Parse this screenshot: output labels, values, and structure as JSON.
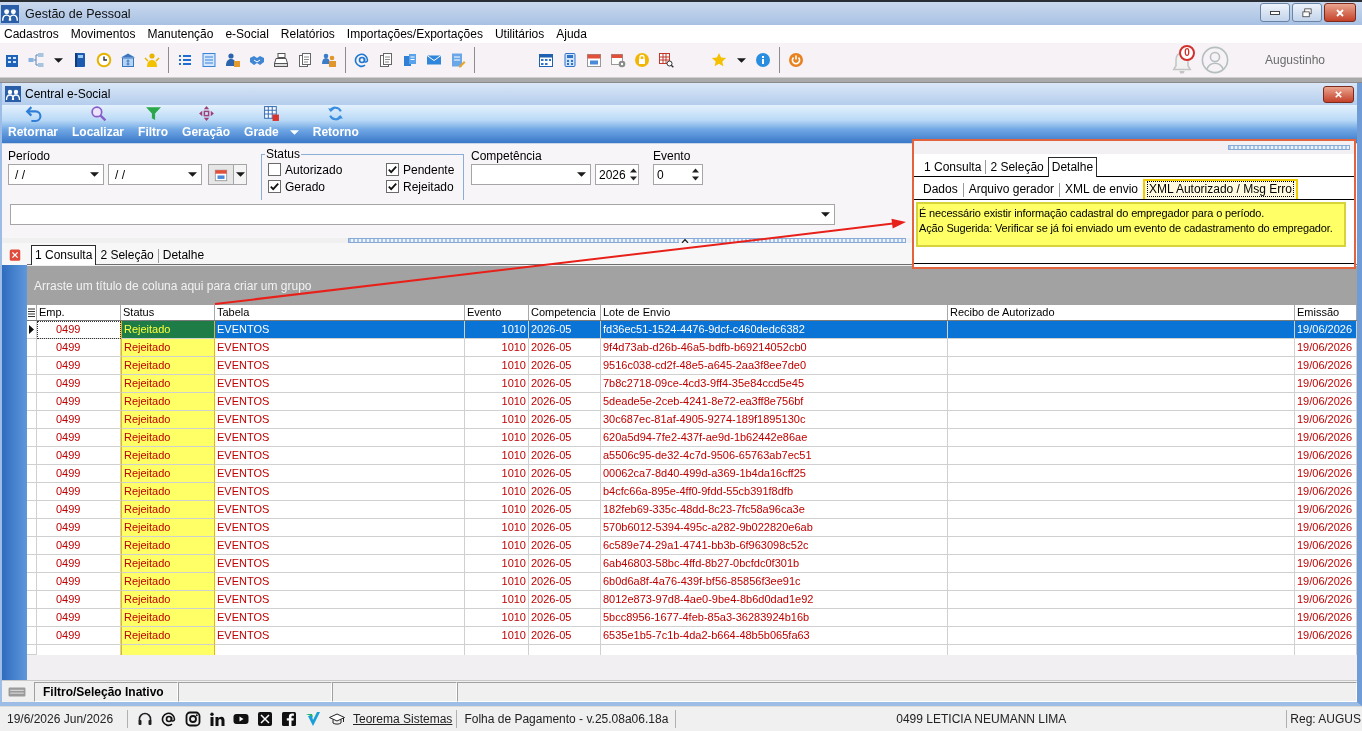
{
  "window": {
    "title": "Gestão de Pessoal"
  },
  "menu": [
    "Cadastros",
    "Movimentos",
    "Manutenção",
    "e-Social",
    "Relatórios",
    "Importações/Exportações",
    "Utilitários",
    "Ajuda"
  ],
  "header": {
    "notifications": "0",
    "user": "Augustinho"
  },
  "child_window": {
    "title": "Central e-Social",
    "toolbar": [
      {
        "label": "Retornar",
        "dropdown": false
      },
      {
        "label": "Localizar",
        "dropdown": false
      },
      {
        "label": "Filtro",
        "dropdown": false
      },
      {
        "label": "Geração",
        "dropdown": false
      },
      {
        "label": "Grade",
        "dropdown": true
      },
      {
        "label": "Retorno",
        "dropdown": false
      }
    ]
  },
  "filters": {
    "period": {
      "label": "Período",
      "from": "/ /",
      "to": "/ /"
    },
    "status": {
      "label": "Status",
      "options": [
        {
          "label": "Autorizado",
          "checked": false
        },
        {
          "label": "Pendente",
          "checked": true
        },
        {
          "label": "Gerado",
          "checked": true
        },
        {
          "label": "Rejeitado",
          "checked": true
        }
      ]
    },
    "competencia": {
      "label": "Competência",
      "year": "2026"
    },
    "evento": {
      "label": "Evento",
      "value": "0"
    }
  },
  "detail_panel": {
    "tabs": [
      {
        "label": "1 Consulta",
        "selected": false
      },
      {
        "label": "2 Seleção",
        "selected": false
      },
      {
        "label": "Detalhe",
        "selected": true
      }
    ],
    "subtabs": [
      {
        "label": "Dados",
        "selected": false
      },
      {
        "label": "Arquivo gerador",
        "selected": false
      },
      {
        "label": "XML de envio",
        "selected": false
      },
      {
        "label": "XML Autorizado / Msg Erro",
        "selected": true
      }
    ],
    "message": [
      "É necessário existir informação cadastral do empregador para o período.",
      "Ação Sugerida: Verificar se já foi enviado um evento de cadastramento do empregador."
    ]
  },
  "tabs": [
    {
      "label": "1 Consulta",
      "selected": true
    },
    {
      "label": "2 Seleção",
      "selected": false
    },
    {
      "label": "Detalhe",
      "selected": false
    }
  ],
  "group_hint": "Arraste um título de coluna aqui para criar um grupo",
  "table": {
    "columns": [
      "Emp.",
      "Status",
      "Tabela",
      "Evento",
      "Competencia",
      "Lote de Envio",
      "Recibo de Autorizado",
      "Emissão"
    ],
    "rows": [
      {
        "selected": true,
        "emp": "0499",
        "status": "Rejeitado",
        "tabela": "EVENTOS",
        "evento": "1010",
        "competencia": "2026-05",
        "lote": "fd36ec51-1524-4476-9dcf-c460dedc6382",
        "emissao": "19/06/2026"
      },
      {
        "selected": false,
        "emp": "0499",
        "status": "Rejeitado",
        "tabela": "EVENTOS",
        "evento": "1010",
        "competencia": "2026-05",
        "lote": "9f4d73ab-d26b-46a5-bdfb-b69214052cb0",
        "emissao": "19/06/2026"
      },
      {
        "selected": false,
        "emp": "0499",
        "status": "Rejeitado",
        "tabela": "EVENTOS",
        "evento": "1010",
        "competencia": "2026-05",
        "lote": "9516c038-cd2f-48e5-a645-2aa3f8ee7de0",
        "emissao": "19/06/2026"
      },
      {
        "selected": false,
        "emp": "0499",
        "status": "Rejeitado",
        "tabela": "EVENTOS",
        "evento": "1010",
        "competencia": "2026-05",
        "lote": "7b8c2718-09ce-4cd3-9ff4-35e84ccd5e45",
        "emissao": "19/06/2026"
      },
      {
        "selected": false,
        "emp": "0499",
        "status": "Rejeitado",
        "tabela": "EVENTOS",
        "evento": "1010",
        "competencia": "2026-05",
        "lote": "5deade5e-2ceb-4241-8e72-ea3ff8e756bf",
        "emissao": "19/06/2026"
      },
      {
        "selected": false,
        "emp": "0499",
        "status": "Rejeitado",
        "tabela": "EVENTOS",
        "evento": "1010",
        "competencia": "2026-05",
        "lote": "30c687ec-81af-4905-9274-189f1895130c",
        "emissao": "19/06/2026"
      },
      {
        "selected": false,
        "emp": "0499",
        "status": "Rejeitado",
        "tabela": "EVENTOS",
        "evento": "1010",
        "competencia": "2026-05",
        "lote": "620a5d94-7fe2-437f-ae9d-1b62442e86ae",
        "emissao": "19/06/2026"
      },
      {
        "selected": false,
        "emp": "0499",
        "status": "Rejeitado",
        "tabela": "EVENTOS",
        "evento": "1010",
        "competencia": "2026-05",
        "lote": "a5506c95-de32-4c7d-9506-65763ab7ec51",
        "emissao": "19/06/2026"
      },
      {
        "selected": false,
        "emp": "0499",
        "status": "Rejeitado",
        "tabela": "EVENTOS",
        "evento": "1010",
        "competencia": "2026-05",
        "lote": "00062ca7-8d40-499d-a369-1b4da16cff25",
        "emissao": "19/06/2026"
      },
      {
        "selected": false,
        "emp": "0499",
        "status": "Rejeitado",
        "tabela": "EVENTOS",
        "evento": "1010",
        "competencia": "2026-05",
        "lote": "b4cfc66a-895e-4ff0-9fdd-55cb391f8dfb",
        "emissao": "19/06/2026"
      },
      {
        "selected": false,
        "emp": "0499",
        "status": "Rejeitado",
        "tabela": "EVENTOS",
        "evento": "1010",
        "competencia": "2026-05",
        "lote": "182feb69-335c-48dd-8c23-7fc58a96ca3e",
        "emissao": "19/06/2026"
      },
      {
        "selected": false,
        "emp": "0499",
        "status": "Rejeitado",
        "tabela": "EVENTOS",
        "evento": "1010",
        "competencia": "2026-05",
        "lote": "570b6012-5394-495c-a282-9b022820e6ab",
        "emissao": "19/06/2026"
      },
      {
        "selected": false,
        "emp": "0499",
        "status": "Rejeitado",
        "tabela": "EVENTOS",
        "evento": "1010",
        "competencia": "2026-05",
        "lote": "6c589e74-29a1-4741-bb3b-6f963098c52c",
        "emissao": "19/06/2026"
      },
      {
        "selected": false,
        "emp": "0499",
        "status": "Rejeitado",
        "tabela": "EVENTOS",
        "evento": "1010",
        "competencia": "2026-05",
        "lote": "6ab46803-58bc-4ffd-8b27-0bcfdc0f301b",
        "emissao": "19/06/2026"
      },
      {
        "selected": false,
        "emp": "0499",
        "status": "Rejeitado",
        "tabela": "EVENTOS",
        "evento": "1010",
        "competencia": "2026-05",
        "lote": "6b0d6a8f-4a76-439f-bf56-85856f3ee91c",
        "emissao": "19/06/2026"
      },
      {
        "selected": false,
        "emp": "0499",
        "status": "Rejeitado",
        "tabela": "EVENTOS",
        "evento": "1010",
        "competencia": "2026-05",
        "lote": "8012e873-97d8-4ae0-9be4-8b6d0dad1e92",
        "emissao": "19/06/2026"
      },
      {
        "selected": false,
        "emp": "0499",
        "status": "Rejeitado",
        "tabela": "EVENTOS",
        "evento": "1010",
        "competencia": "2026-05",
        "lote": "5bcc8956-1677-4feb-85a3-36283924b16b",
        "emissao": "19/06/2026"
      },
      {
        "selected": false,
        "emp": "0499",
        "status": "Rejeitado",
        "tabela": "EVENTOS",
        "evento": "1010",
        "competencia": "2026-05",
        "lote": "6535e1b5-7c1b-4da2-b664-48b5b065fa63",
        "emissao": "19/06/2026"
      }
    ]
  },
  "status_strip": {
    "filter_state": "Filtro/Seleção Inativo"
  },
  "status_bar": {
    "date": "19/6/2026 Jun/2026",
    "link": "Teorema Sistemas",
    "product": "Folha de Pagamento - v.25.08a06.18a",
    "company": "0499 LETICIA NEUMANN LIMA",
    "registration": "Reg: AUGUS"
  }
}
